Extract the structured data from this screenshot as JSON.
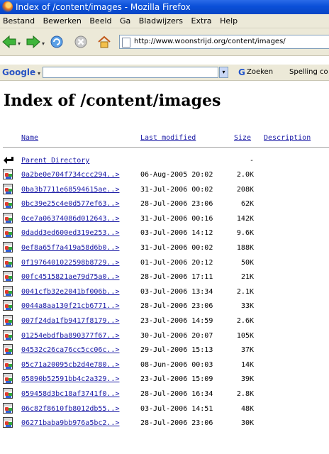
{
  "window": {
    "title": "Index of /content/images - Mozilla Firefox"
  },
  "menubar": {
    "items": [
      "Bestand",
      "Bewerken",
      "Beeld",
      "Ga",
      "Bladwijzers",
      "Extra",
      "Help"
    ]
  },
  "navbar": {
    "url": "http://www.woonstrijd.org/content/images/"
  },
  "searchbar": {
    "logo": "Google",
    "query": "",
    "search_button": "Zoeken",
    "spelling_button": "Spelling co"
  },
  "page": {
    "title": "Index of /content/images",
    "columns": {
      "name": "Name",
      "modified": "Last modified",
      "size": "Size",
      "description": "Description"
    },
    "parent": {
      "name": "Parent Directory",
      "size": "-"
    },
    "rows": [
      {
        "name": "0a2be0e704f734ccc294..>",
        "modified": "06-Aug-2005 20:02",
        "size": "2.0K"
      },
      {
        "name": "0ba3b7711e68594615ae..>",
        "modified": "31-Jul-2006 00:02",
        "size": "208K"
      },
      {
        "name": "0bc39e25c4e0d577ef63..>",
        "modified": "28-Jul-2006 23:06",
        "size": "62K"
      },
      {
        "name": "0ce7a06374086d012643..>",
        "modified": "31-Jul-2006 00:16",
        "size": "142K"
      },
      {
        "name": "0dadd3ed600ed319e253..>",
        "modified": "03-Jul-2006 14:12",
        "size": "9.6K"
      },
      {
        "name": "0ef8a65f7a419a58d6b0..>",
        "modified": "31-Jul-2006 00:02",
        "size": "188K"
      },
      {
        "name": "0f1976401022598b8729..>",
        "modified": "01-Jul-2006 20:12",
        "size": "50K"
      },
      {
        "name": "00fc4515821ae79d75a0..>",
        "modified": "28-Jul-2006 17:11",
        "size": "21K"
      },
      {
        "name": "0041cfb32e2041bf006b..>",
        "modified": "03-Jul-2006 13:34",
        "size": "2.1K"
      },
      {
        "name": "0044a8aa130f21cb6771..>",
        "modified": "28-Jul-2006 23:06",
        "size": "33K"
      },
      {
        "name": "007f24da1fb9417f8179..>",
        "modified": "23-Jul-2006 14:59",
        "size": "2.6K"
      },
      {
        "name": "01254ebdfba890377f67..>",
        "modified": "30-Jul-2006 20:07",
        "size": "105K"
      },
      {
        "name": "04532c26ca76cc5cc06c..>",
        "modified": "29-Jul-2006 15:13",
        "size": "37K"
      },
      {
        "name": "05c71a20095cb2d4e780..>",
        "modified": "08-Jun-2006 00:03",
        "size": "14K"
      },
      {
        "name": "05890b52591bb4c2a329..>",
        "modified": "23-Jul-2006 15:09",
        "size": "39K"
      },
      {
        "name": "059458d3bc18af3741f0..>",
        "modified": "28-Jul-2006 16:34",
        "size": "2.8K"
      },
      {
        "name": "06c82f8610fb8012db55..>",
        "modified": "03-Jul-2006 14:51",
        "size": "48K"
      },
      {
        "name": "06271baba9bb976a5bc2..>",
        "modified": "28-Jul-2006 23:06",
        "size": "30K"
      }
    ]
  },
  "colors": {
    "link": "#1a1aa6",
    "titlebar": "#0a4fd8",
    "chrome": "#ece9d8"
  },
  "icons": {
    "file_row": "image-file-icon",
    "parent_row": "back-arrow-icon"
  }
}
